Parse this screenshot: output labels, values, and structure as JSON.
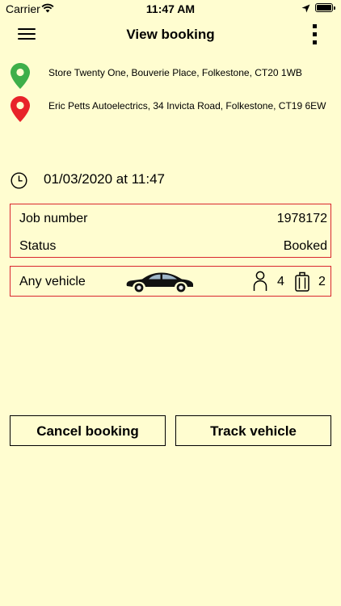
{
  "status_bar": {
    "carrier": "Carrier",
    "time": "11:47 AM"
  },
  "nav": {
    "title": "View booking"
  },
  "pickup": {
    "address": "Store Twenty One, Bouverie Place, Folkestone, CT20 1WB",
    "pin_color": "#3EAF4A"
  },
  "dropoff": {
    "address": "Eric Petts Autoelectrics, 34 Invicta Road, Folkestone, CT19 6EW",
    "pin_color": "#E8232A"
  },
  "booking_time": "01/03/2020 at 11:47",
  "details": {
    "job_number_label": "Job number",
    "job_number": "1978172",
    "status_label": "Status",
    "status": "Booked"
  },
  "vehicle": {
    "type": "Any vehicle",
    "passengers": "4",
    "luggage": "2"
  },
  "actions": {
    "cancel": "Cancel booking",
    "track": "Track vehicle"
  },
  "colors": {
    "background": "#FFFDD0",
    "box_border": "#D9262E"
  }
}
